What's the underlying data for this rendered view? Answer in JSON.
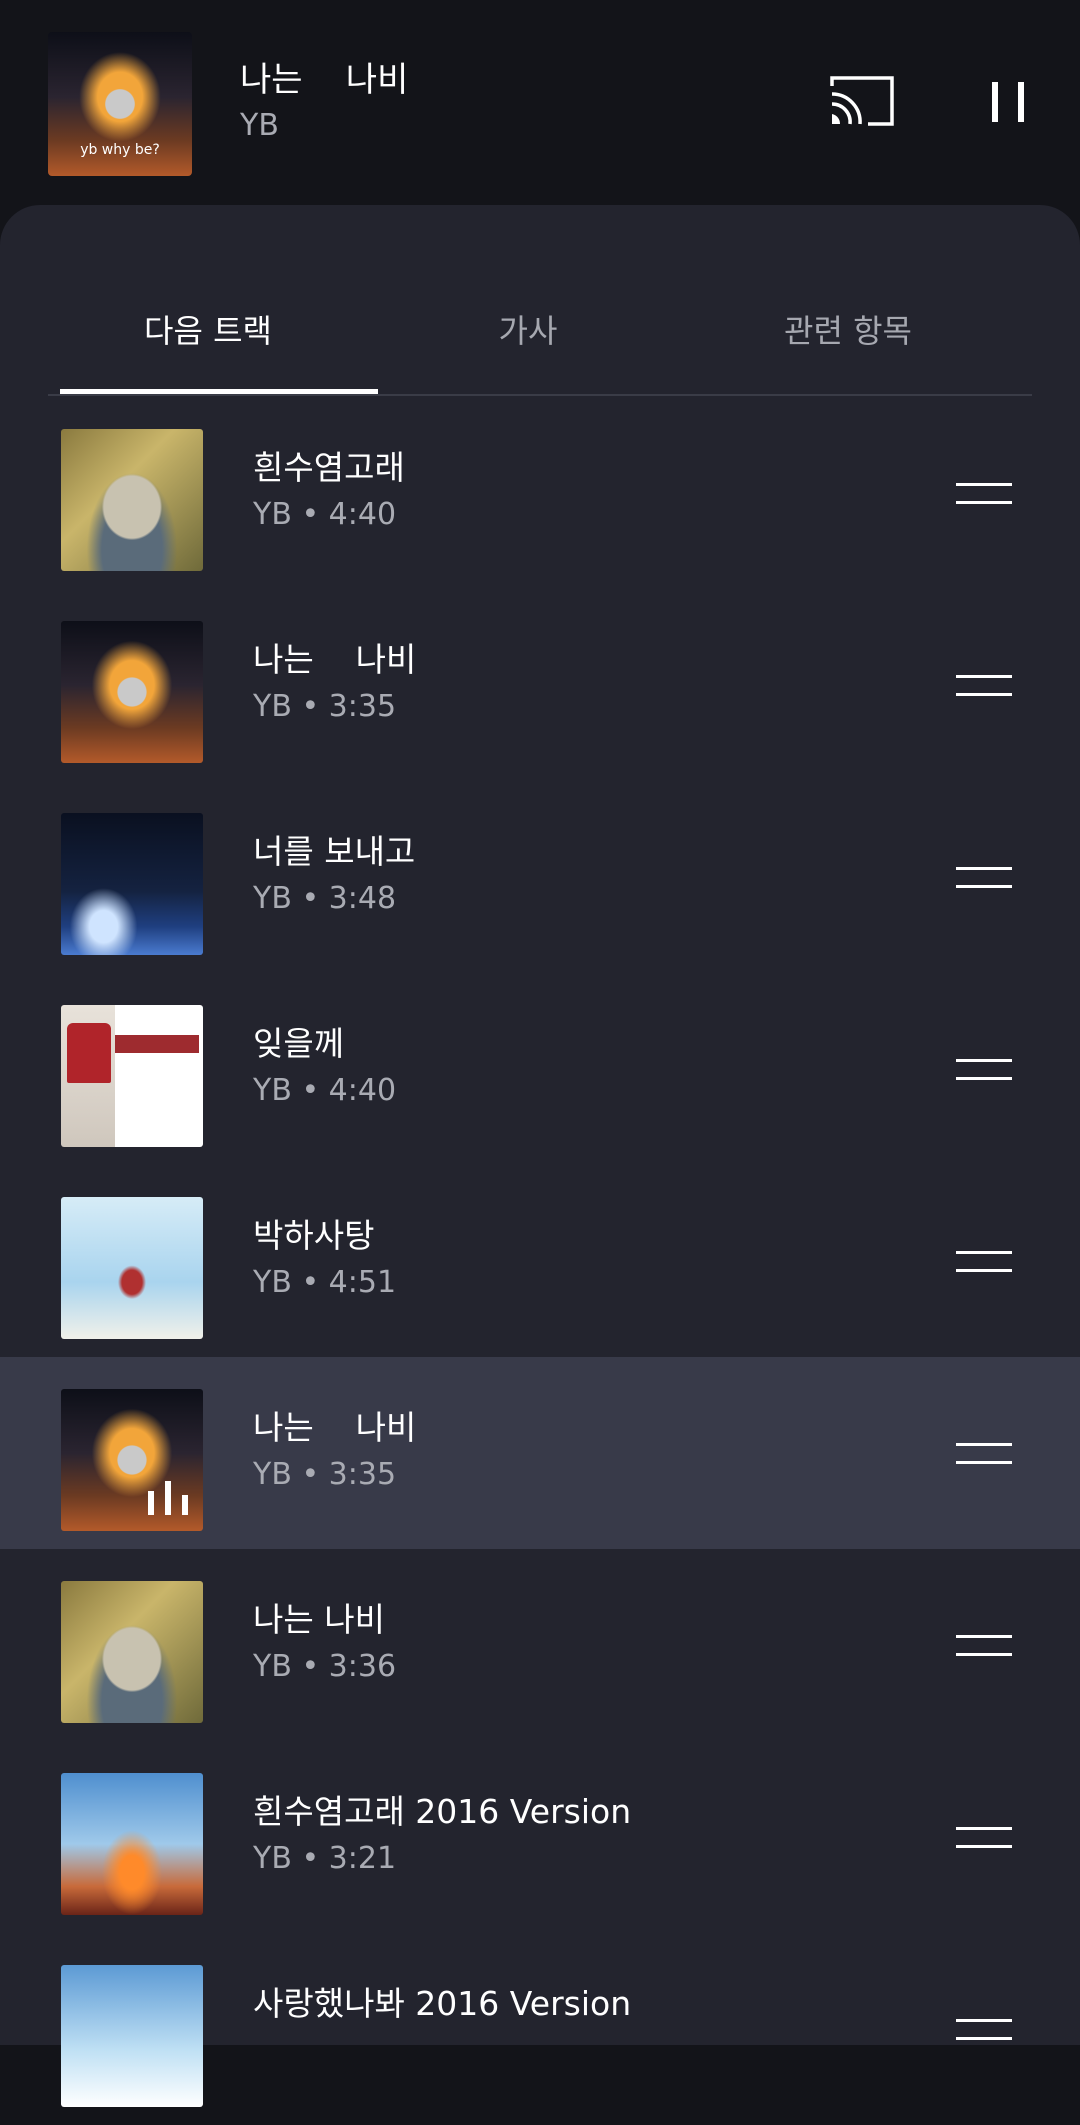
{
  "now_playing": {
    "title": "나는    나비",
    "artist": "YB",
    "art_caption": "yb      why be?"
  },
  "controls": {
    "cast_icon": "cast-icon",
    "pause_icon": "pause-icon"
  },
  "tabs": [
    {
      "label": "다음 트랙",
      "active": true
    },
    {
      "label": "가사",
      "active": false
    },
    {
      "label": "관련 항목",
      "active": false
    }
  ],
  "queue": [
    {
      "title": "흰수염고래",
      "meta": "YB • 4:40",
      "art": "whale"
    },
    {
      "title": "나는    나비",
      "meta": "YB • 3:35",
      "art": "wing"
    },
    {
      "title": "너를 보내고",
      "meta": "YB • 3:48",
      "art": "night"
    },
    {
      "title": "잊을께",
      "meta": "YB • 4:40",
      "art": "stream"
    },
    {
      "title": "박하사탕",
      "meta": "YB • 4:51",
      "art": "sky"
    },
    {
      "title": "나는    나비",
      "meta": "YB • 3:35",
      "art": "wing",
      "playing": true
    },
    {
      "title": "나는 나비",
      "meta": "YB • 3:36",
      "art": "whale"
    },
    {
      "title": "흰수염고래 2016 Version",
      "meta": "YB • 3:21",
      "art": "fire"
    },
    {
      "title": "사랑했나봐 2016 Version",
      "meta": "",
      "art": "sky2"
    }
  ],
  "colors": {
    "background": "#131419",
    "sheet": "#23242e",
    "playing_row": "#383a49",
    "secondary_text": "#a9abb3"
  }
}
